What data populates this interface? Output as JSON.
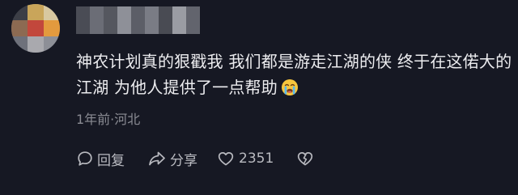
{
  "comment": {
    "text": "神农计划真的狠戳我 我们都是游走江湖的侠 终于在这偌大的江湖 为他人提供了一点帮助",
    "emoji": "loudly-crying-face"
  },
  "meta": {
    "time_location": "1年前·河北"
  },
  "actions": {
    "reply_label": "回复",
    "share_label": "分享",
    "like_count": "2351"
  },
  "colors": {
    "background": "#161823",
    "comment_text": "#ececef",
    "meta_text": "#8a8b93",
    "action_text": "#b9bac0"
  },
  "icons": [
    "reply-icon",
    "share-icon",
    "heart-icon",
    "dislike-icon"
  ]
}
